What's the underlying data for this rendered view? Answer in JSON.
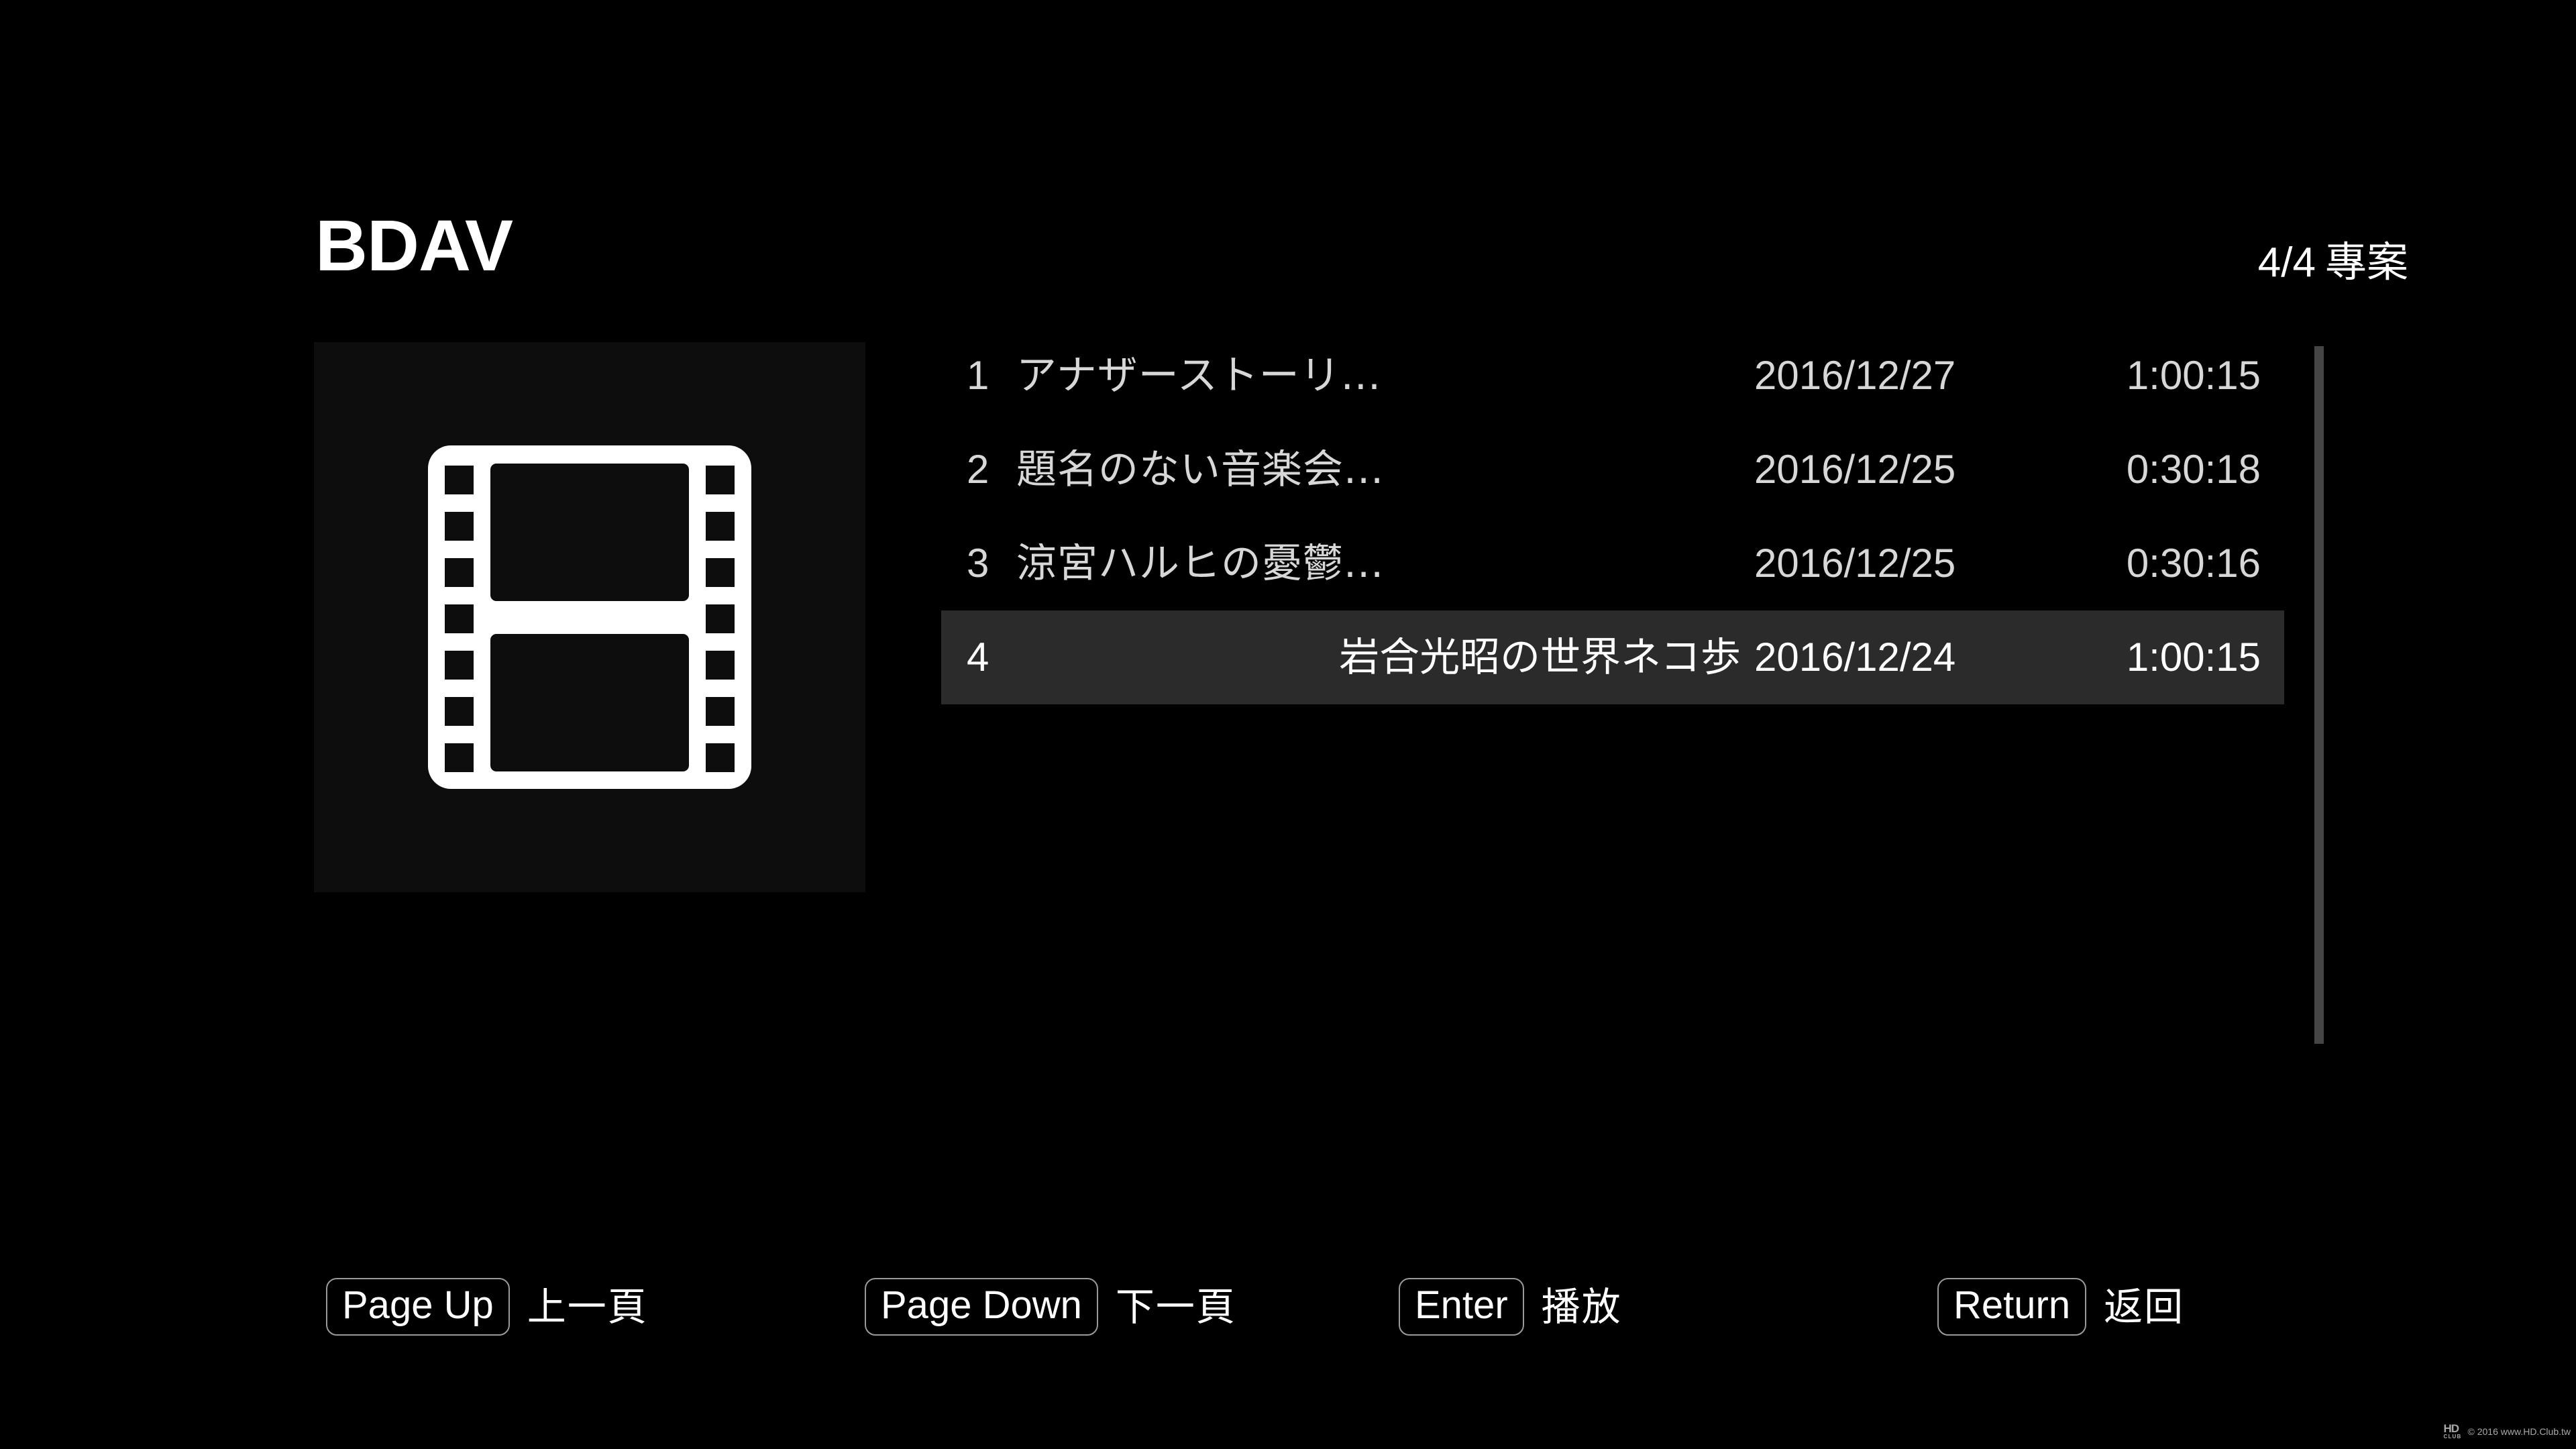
{
  "header": {
    "app_title": "BDAV",
    "page_counter_number": "4/4",
    "page_counter_label": "專案"
  },
  "thumbnail": {
    "icon": "film-strip-icon"
  },
  "list": {
    "columns": [
      "index",
      "title",
      "date",
      "duration"
    ],
    "rows": [
      {
        "index": "1",
        "title": "アナザーストーリ...",
        "date": "2016/12/27",
        "duration": "1:00:15",
        "selected": false
      },
      {
        "index": "2",
        "title": "題名のない音楽会...",
        "date": "2016/12/25",
        "duration": "0:30:18",
        "selected": false
      },
      {
        "index": "3",
        "title": "涼宮ハルヒの憂鬱...",
        "date": "2016/12/25",
        "duration": "0:30:16",
        "selected": false
      },
      {
        "index": "4",
        "title": "岩合光昭の世界ネコ歩",
        "date": "2016/12/24",
        "duration": "1:00:15",
        "selected": true
      }
    ]
  },
  "scrollbar": {
    "name": "vertical-scrollbar",
    "thumb_color": "#454545"
  },
  "footer": {
    "hints": [
      {
        "key": "Page Up",
        "label": "上一頁"
      },
      {
        "key": "Page Down",
        "label": "下一頁"
      },
      {
        "key": "Enter",
        "label": "播放"
      },
      {
        "key": "Return",
        "label": "返回"
      }
    ]
  },
  "watermark": {
    "logo_top": "HD",
    "logo_bottom": "CLUB",
    "text": "© 2016  www.HD.Club.tw"
  },
  "colors": {
    "background": "#000000",
    "panel": "#0d0d0d",
    "row_selected": "#2b2b2b",
    "text": "#ffffff",
    "text_dim": "#d7d7d7",
    "key_border": "#9a9a9a"
  }
}
